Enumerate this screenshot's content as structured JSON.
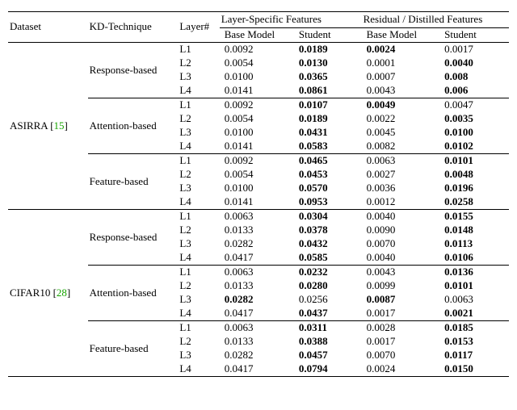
{
  "headers": {
    "dataset": "Dataset",
    "kd": "KD-Technique",
    "layer": "Layer#",
    "group1": "Layer-Specific Features",
    "group2": "Residual / Distilled Features",
    "bm": "Base Model",
    "st": "Student"
  },
  "datasets": [
    {
      "name_pre": "ASIRRA [",
      "cite": "15",
      "name_post": "]",
      "cite_class": "cite-a",
      "techniques": [
        {
          "name": "Response-based",
          "rows": [
            {
              "layer": "L1",
              "bm1": "0.0092",
              "st1": "0.0189",
              "b_st1": true,
              "bm2": "0.0024",
              "b_bm2": true,
              "st2": "0.0017"
            },
            {
              "layer": "L2",
              "bm1": "0.0054",
              "st1": "0.0130",
              "b_st1": true,
              "bm2": "0.0001",
              "st2": "0.0040",
              "b_st2": true
            },
            {
              "layer": "L3",
              "bm1": "0.0100",
              "st1": "0.0365",
              "b_st1": true,
              "bm2": "0.0007",
              "st2": "0.008",
              "b_st2": true
            },
            {
              "layer": "L4",
              "bm1": "0.0141",
              "st1": "0.0861",
              "b_st1": true,
              "bm2": "0.0043",
              "st2": "0.006",
              "b_st2": true
            }
          ]
        },
        {
          "name": "Attention-based",
          "rows": [
            {
              "layer": "L1",
              "bm1": "0.0092",
              "st1": "0.0107",
              "b_st1": true,
              "bm2": "0.0049",
              "b_bm2": true,
              "st2": "0.0047"
            },
            {
              "layer": "L2",
              "bm1": "0.0054",
              "st1": "0.0189",
              "b_st1": true,
              "bm2": "0.0022",
              "st2": "0.0035",
              "b_st2": true
            },
            {
              "layer": "L3",
              "bm1": "0.0100",
              "st1": "0.0431",
              "b_st1": true,
              "bm2": "0.0045",
              "st2": "0.0100",
              "b_st2": true
            },
            {
              "layer": "L4",
              "bm1": "0.0141",
              "st1": "0.0583",
              "b_st1": true,
              "bm2": "0.0082",
              "st2": "0.0102",
              "b_st2": true
            }
          ]
        },
        {
          "name": "Feature-based",
          "rows": [
            {
              "layer": "L1",
              "bm1": "0.0092",
              "st1": "0.0465",
              "b_st1": true,
              "bm2": "0.0063",
              "st2": "0.0101",
              "b_st2": true
            },
            {
              "layer": "L2",
              "bm1": "0.0054",
              "st1": "0.0453",
              "b_st1": true,
              "bm2": "0.0027",
              "st2": "0.0048",
              "b_st2": true
            },
            {
              "layer": "L3",
              "bm1": "0.0100",
              "st1": "0.0570",
              "b_st1": true,
              "bm2": "0.0036",
              "st2": "0.0196",
              "b_st2": true
            },
            {
              "layer": "L4",
              "bm1": "0.0141",
              "st1": "0.0953",
              "b_st1": true,
              "bm2": "0.0012",
              "st2": "0.0258",
              "b_st2": true
            }
          ]
        }
      ]
    },
    {
      "name_pre": "CIFAR10 [",
      "cite": "28",
      "name_post": "]",
      "cite_class": "cite-b",
      "techniques": [
        {
          "name": "Response-based",
          "rows": [
            {
              "layer": "L1",
              "bm1": "0.0063",
              "st1": "0.0304",
              "b_st1": true,
              "bm2": "0.0040",
              "st2": "0.0155",
              "b_st2": true
            },
            {
              "layer": "L2",
              "bm1": "0.0133",
              "st1": "0.0378",
              "b_st1": true,
              "bm2": "0.0090",
              "st2": "0.0148",
              "b_st2": true
            },
            {
              "layer": "L3",
              "bm1": "0.0282",
              "st1": "0.0432",
              "b_st1": true,
              "bm2": "0.0070",
              "st2": "0.0113",
              "b_st2": true
            },
            {
              "layer": "L4",
              "bm1": "0.0417",
              "st1": "0.0585",
              "b_st1": true,
              "bm2": "0.0040",
              "st2": "0.0106",
              "b_st2": true
            }
          ]
        },
        {
          "name": "Attention-based",
          "rows": [
            {
              "layer": "L1",
              "bm1": "0.0063",
              "st1": "0.0232",
              "b_st1": true,
              "bm2": "0.0043",
              "st2": "0.0136",
              "b_st2": true
            },
            {
              "layer": "L2",
              "bm1": "0.0133",
              "st1": "0.0280",
              "b_st1": true,
              "bm2": "0.0099",
              "st2": "0.0101",
              "b_st2": true
            },
            {
              "layer": "L3",
              "bm1": "0.0282",
              "b_bm1": true,
              "st1": "0.0256",
              "bm2": "0.0087",
              "b_bm2": true,
              "st2": "0.0063"
            },
            {
              "layer": "L4",
              "bm1": "0.0417",
              "st1": "0.0437",
              "b_st1": true,
              "bm2": "0.0017",
              "st2": "0.0021",
              "b_st2": true
            }
          ]
        },
        {
          "name": "Feature-based",
          "rows": [
            {
              "layer": "L1",
              "bm1": "0.0063",
              "st1": "0.0311",
              "b_st1": true,
              "bm2": "0.0028",
              "st2": "0.0185",
              "b_st2": true
            },
            {
              "layer": "L2",
              "bm1": "0.0133",
              "st1": "0.0388",
              "b_st1": true,
              "bm2": "0.0017",
              "st2": "0.0153",
              "b_st2": true
            },
            {
              "layer": "L3",
              "bm1": "0.0282",
              "st1": "0.0457",
              "b_st1": true,
              "bm2": "0.0070",
              "st2": "0.0117",
              "b_st2": true
            },
            {
              "layer": "L4",
              "bm1": "0.0417",
              "st1": "0.0794",
              "b_st1": true,
              "bm2": "0.0024",
              "st2": "0.0150",
              "b_st2": true
            }
          ]
        }
      ]
    }
  ]
}
